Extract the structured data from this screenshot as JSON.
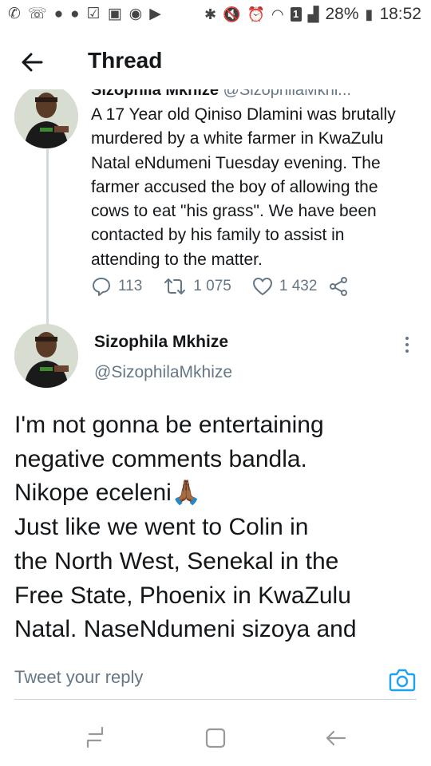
{
  "status_bar": {
    "left_icons": [
      "whatsapp-icon",
      "missed-call-icon",
      "chat-bubble-icon",
      "chat-bubble-icon",
      "checkbox-icon",
      "gallery-icon",
      "camera-icon",
      "play-icon"
    ],
    "battery_percent": "28%",
    "time": "18:52",
    "sim_label": "1"
  },
  "header": {
    "title": "Thread"
  },
  "parent_tweet": {
    "header_fragment_name": "Sizophila Mkhize",
    "header_fragment_handle": "@SizophilaMkhi...",
    "text": "A 17 Year old Qiniso Dlamini was brutally murdered by a white farmer in KwaZulu Natal eNdumeni Tuesday evening. The farmer accused the boy of allowing the cows to eat \"his grass\". We have been contacted by his family to assist in attending to the matter.",
    "replies": "113",
    "retweets": "1 075",
    "likes": "1 432"
  },
  "main_tweet": {
    "author_name": "Sizophila Mkhize",
    "author_handle": "@SizophilaMkhize",
    "text": "I'm not gonna be entertaining\nnegative comments bandla.\nNikope eceleni🙏🏾\nJust like we went to Colin in\nthe North West, Senekal in the\nFree State, Phoenix in KwaZulu\nNatal. NaseNdumeni sizoya and"
  },
  "reply_bar": {
    "placeholder": "Tweet your reply"
  },
  "colors": {
    "text_primary": "#14171a",
    "text_secondary": "#657786",
    "accent": "#1da1f2",
    "thread_line": "#cfd9de",
    "divider": "#ccd6dd"
  }
}
